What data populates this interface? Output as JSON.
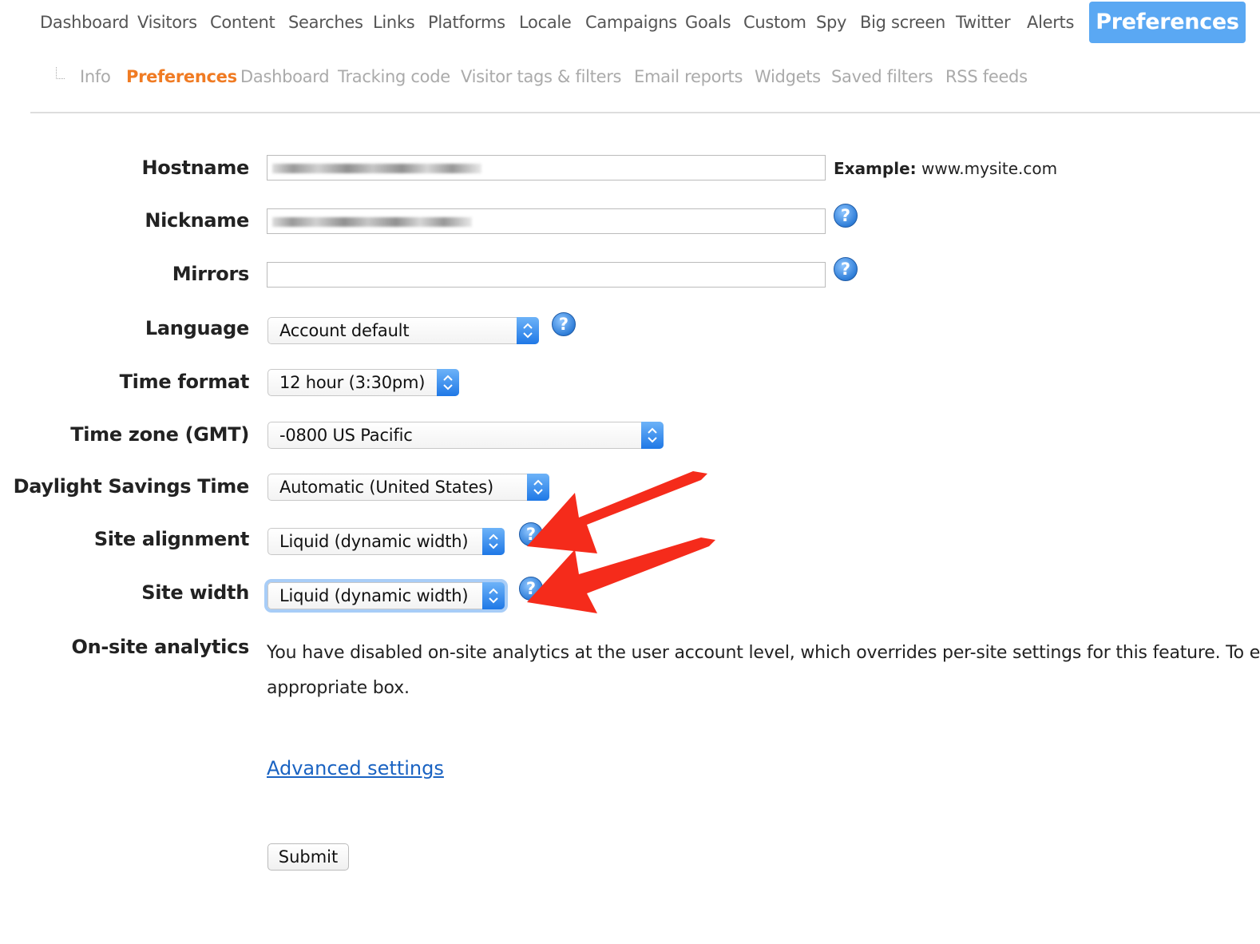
{
  "top_nav": {
    "items": [
      "Dashboard",
      "Visitors",
      "Content",
      "Searches",
      "Links",
      "Platforms",
      "Locale",
      "Campaigns",
      "Goals",
      "Custom",
      "Spy",
      "Big screen",
      "Twitter",
      "Alerts"
    ],
    "active": "Preferences"
  },
  "sub_nav": {
    "items": [
      "Info",
      "Preferences",
      "Dashboard",
      "Tracking code",
      "Visitor tags & filters",
      "Email reports",
      "Widgets",
      "Saved filters",
      "RSS feeds"
    ],
    "active_index": 1
  },
  "form": {
    "hostname": {
      "label": "Hostname",
      "value": "",
      "example_label": "Example:",
      "example_value": "www.mysite.com"
    },
    "nickname": {
      "label": "Nickname",
      "value": ""
    },
    "mirrors": {
      "label": "Mirrors",
      "value": ""
    },
    "language": {
      "label": "Language",
      "value": "Account default"
    },
    "time_format": {
      "label": "Time format",
      "value": "12 hour (3:30pm)"
    },
    "time_zone": {
      "label": "Time zone (GMT)",
      "value": "-0800 US Pacific"
    },
    "dst": {
      "label": "Daylight Savings Time",
      "value": "Automatic (United States)"
    },
    "site_alignment": {
      "label": "Site alignment",
      "value": "Liquid (dynamic width)"
    },
    "site_width": {
      "label": "Site width",
      "value": "Liquid (dynamic width)"
    },
    "onsite": {
      "label": "On-site analytics",
      "line1": "You have disabled on-site analytics at the user account level, which overrides per-site settings for this feature. To e",
      "line2": "appropriate box."
    },
    "advanced_link": "Advanced settings",
    "submit_label": "Submit",
    "help_glyph": "?"
  },
  "colors": {
    "accent_blue": "#5aa8f3",
    "active_orange": "#f07b23",
    "arrow_red": "#f52b1b",
    "link_blue": "#1a63c2"
  },
  "icons": [
    "help-icon",
    "select-stepper-icon",
    "annotation-arrow"
  ]
}
